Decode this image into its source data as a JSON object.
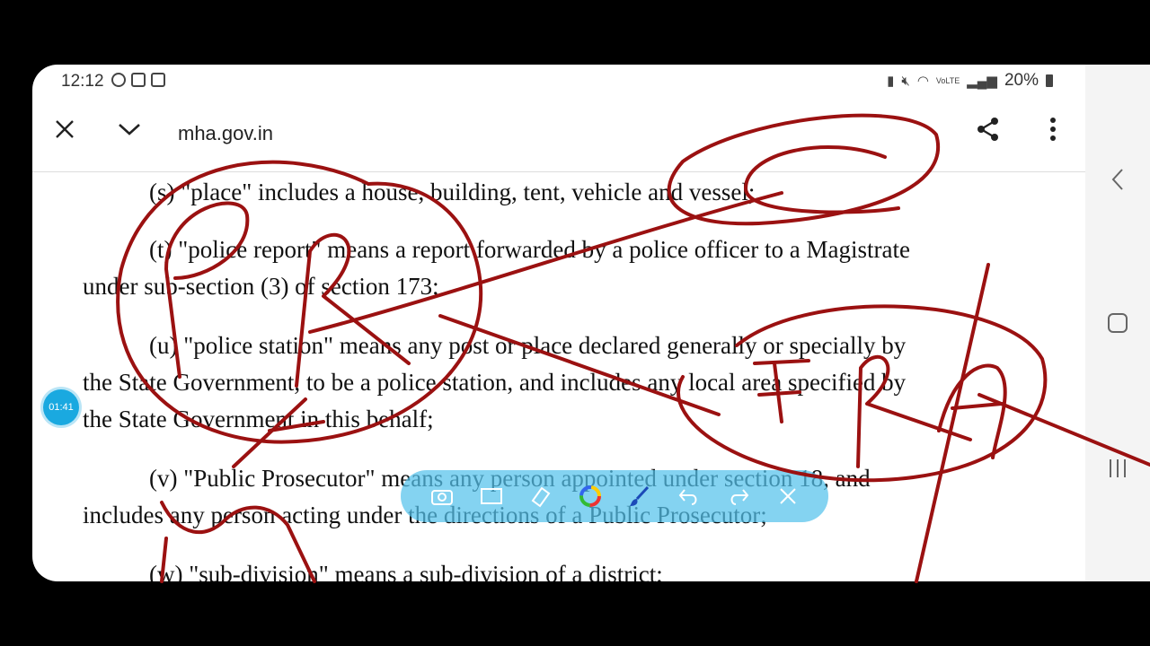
{
  "status_bar": {
    "time": "12:12",
    "battery": "20%",
    "network": "VoLTE"
  },
  "toolbar": {
    "url": "mha.gov.in"
  },
  "content": {
    "paragraphs": [
      {
        "lines": [
          "(s) \"place\" includes a house, building, tent, vehicle and vessel;"
        ]
      },
      {
        "lines": [
          "(t) \"police report\" means a report forwarded by a police officer to a Magistrate",
          "under sub-section (3) of section 173;"
        ]
      },
      {
        "lines": [
          "(u) \"police station\" means any post or place declared generally or specially by",
          "the State Government, to be a police station, and includes any local area specified by",
          "the State Government in this behalf;"
        ]
      },
      {
        "lines": [
          "(v) \"Public Prosecutor\" means any person appointed under section 18, and",
          "includes any person acting under the directions of a Public Prosecutor;"
        ]
      },
      {
        "lines": [
          "(w) \"sub-division\" means a sub-division of a district;"
        ]
      }
    ]
  },
  "recording_timer": "01:41",
  "drawing_toolbar": {
    "tools": [
      "camera-icon",
      "rectangle-icon",
      "eraser-icon",
      "color-picker-icon",
      "brush-icon",
      "undo-icon",
      "redo-icon",
      "close-icon"
    ]
  },
  "colors": {
    "annotation_ink": "#9b1111",
    "timer": "#1aa9e0",
    "drawing_toolbar": "#54c2ec"
  }
}
